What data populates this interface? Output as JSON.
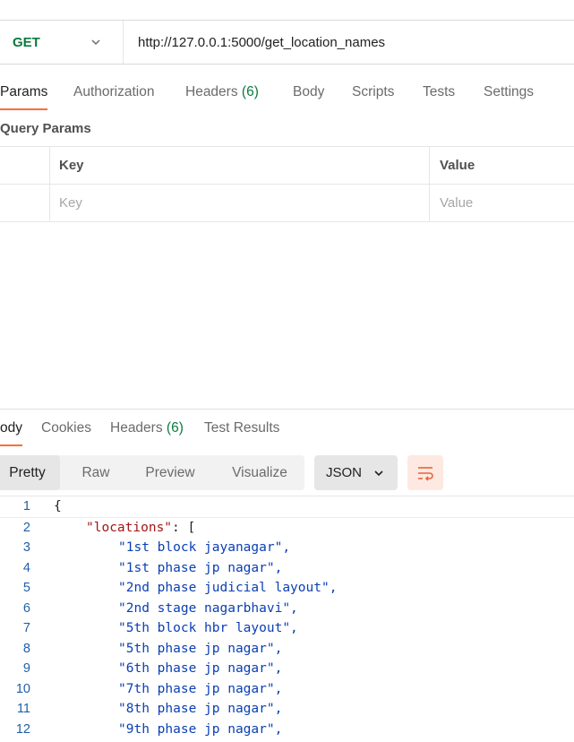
{
  "request": {
    "method": "GET",
    "url": "http://127.0.0.1:5000/get_location_names"
  },
  "request_tabs": [
    {
      "label": "Params",
      "active": true
    },
    {
      "label": "Authorization"
    },
    {
      "label": "Headers",
      "count": "(6)"
    },
    {
      "label": "Body"
    },
    {
      "label": "Scripts"
    },
    {
      "label": "Tests"
    },
    {
      "label": "Settings"
    }
  ],
  "query_params": {
    "title": "Query Params",
    "columns": {
      "key": "Key",
      "value": "Value"
    },
    "placeholders": {
      "key": "Key",
      "value": "Value"
    }
  },
  "response_tabs": [
    {
      "label": "Body",
      "visible_text": "ody",
      "active": true
    },
    {
      "label": "Cookies"
    },
    {
      "label": "Headers",
      "count": "(6)"
    },
    {
      "label": "Test Results"
    }
  ],
  "view_modes": [
    {
      "label": "Pretty",
      "active": true
    },
    {
      "label": "Raw"
    },
    {
      "label": "Preview"
    },
    {
      "label": "Visualize"
    }
  ],
  "format": {
    "selected": "JSON"
  },
  "icons": {
    "method_dropdown": "chevron-down-icon",
    "format_dropdown": "chevron-down-icon",
    "wrap": "wrap-lines-icon"
  },
  "colors": {
    "accent": "#ff6c37",
    "method": "#0b7a3e",
    "count": "#0b7a3e",
    "json_key": "#a31515",
    "json_string": "#0a3fb3",
    "line_number": "#1f5fa8"
  },
  "response_body": {
    "lines": [
      {
        "n": "1",
        "text": "{"
      },
      {
        "n": "2",
        "key": "\"locations\"",
        "rest": ": ["
      },
      {
        "n": "3",
        "text": "\"1st block jayanagar\","
      },
      {
        "n": "4",
        "text": "\"1st phase jp nagar\","
      },
      {
        "n": "5",
        "text": "\"2nd phase judicial layout\","
      },
      {
        "n": "6",
        "text": "\"2nd stage nagarbhavi\","
      },
      {
        "n": "7",
        "text": "\"5th block hbr layout\","
      },
      {
        "n": "8",
        "text": "\"5th phase jp nagar\","
      },
      {
        "n": "9",
        "text": "\"6th phase jp nagar\","
      },
      {
        "n": "10",
        "text": "\"7th phase jp nagar\","
      },
      {
        "n": "11",
        "text": "\"8th phase jp nagar\","
      },
      {
        "n": "12",
        "text": "\"9th phase jp nagar\","
      }
    ]
  }
}
